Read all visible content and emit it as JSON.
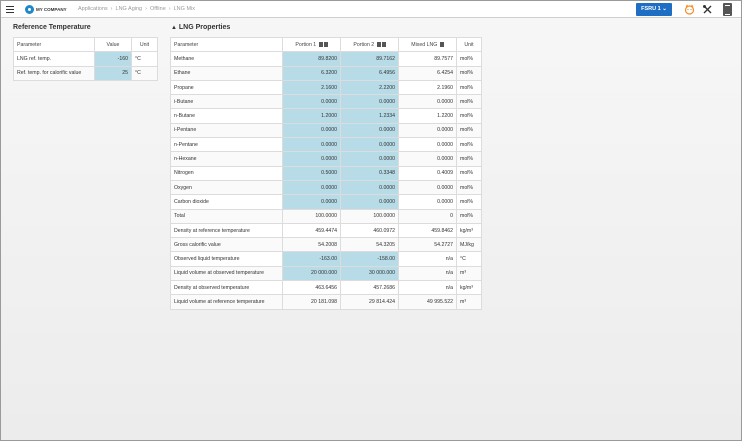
{
  "header": {
    "company": "MY COMPANY",
    "breadcrumbs": [
      "Applications",
      "LNG Aging",
      "Offline",
      "LNG Mix"
    ],
    "fsru_button": "FSRU 1",
    "icons": [
      "menu-icon",
      "company-logo-icon",
      "face-icon",
      "tools-icon",
      "document-icon"
    ]
  },
  "ref_temp": {
    "title": "Reference Temperature",
    "columns": [
      "Parameter",
      "Value",
      "Unit"
    ],
    "rows": [
      {
        "param": "LNG ref. temp.",
        "value": "-160",
        "unit": "°C"
      },
      {
        "param": "Ref. temp. for calorific value",
        "value": "25",
        "unit": "°C"
      }
    ]
  },
  "lng": {
    "title": "LNG Properties",
    "columns": [
      "Parameter",
      "Portion 1",
      "Portion 2",
      "Mixed LNG",
      "Unit"
    ],
    "rows": [
      {
        "param": "Methane",
        "p1": "89.8200",
        "p2": "89.7162",
        "mix": "89.7577",
        "unit": "mol%"
      },
      {
        "param": "Ethane",
        "p1": "6.3200",
        "p2": "6.4956",
        "mix": "6.4254",
        "unit": "mol%"
      },
      {
        "param": "Propane",
        "p1": "2.1600",
        "p2": "2.2200",
        "mix": "2.1960",
        "unit": "mol%"
      },
      {
        "param": "i-Butane",
        "p1": "0.0000",
        "p2": "0.0000",
        "mix": "0.0000",
        "unit": "mol%"
      },
      {
        "param": "n-Butane",
        "p1": "1.2000",
        "p2": "1.2334",
        "mix": "1.2200",
        "unit": "mol%"
      },
      {
        "param": "i-Pentane",
        "p1": "0.0000",
        "p2": "0.0000",
        "mix": "0.0000",
        "unit": "mol%"
      },
      {
        "param": "n-Pentane",
        "p1": "0.0000",
        "p2": "0.0000",
        "mix": "0.0000",
        "unit": "mol%"
      },
      {
        "param": "n-Hexane",
        "p1": "0.0000",
        "p2": "0.0000",
        "mix": "0.0000",
        "unit": "mol%"
      },
      {
        "param": "Nitrogen",
        "p1": "0.5000",
        "p2": "0.3348",
        "mix": "0.4009",
        "unit": "mol%"
      },
      {
        "param": "Oxygen",
        "p1": "0.0000",
        "p2": "0.0000",
        "mix": "0.0000",
        "unit": "mol%"
      },
      {
        "param": "Carbon dioxide",
        "p1": "0.0000",
        "p2": "0.0000",
        "mix": "0.0000",
        "unit": "mol%"
      },
      {
        "param": "Total",
        "p1": "100.0000",
        "p2": "100.0000",
        "mix": "0",
        "unit": "mol%"
      },
      {
        "param": "Density at reference temperature",
        "p1": "459.4474",
        "p2": "460.0972",
        "mix": "459.8462",
        "unit": "kg/m³"
      },
      {
        "param": "Gross calorific value",
        "p1": "54.2008",
        "p2": "54.3205",
        "mix": "54.2727",
        "unit": "MJ/kg"
      },
      {
        "param": "Observed liquid temperature",
        "p1": "-163.00",
        "p2": "-158.00",
        "mix": "n/a",
        "unit": "°C"
      },
      {
        "param": "Liquid volume at observed temperature",
        "p1": "20 000.000",
        "p2": "30 000.000",
        "mix": "n/a",
        "unit": "m³"
      },
      {
        "param": "Density at observed temperature",
        "p1": "463.6456",
        "p2": "457.2686",
        "mix": "n/a",
        "unit": "kg/m³"
      },
      {
        "param": "Liquid volume at reference temperature",
        "p1": "20 181.098",
        "p2": "29 814.424",
        "mix": "49 995.522",
        "unit": "m³"
      }
    ],
    "highlight_rows": 11,
    "highlight_extra": [
      14,
      15
    ]
  }
}
